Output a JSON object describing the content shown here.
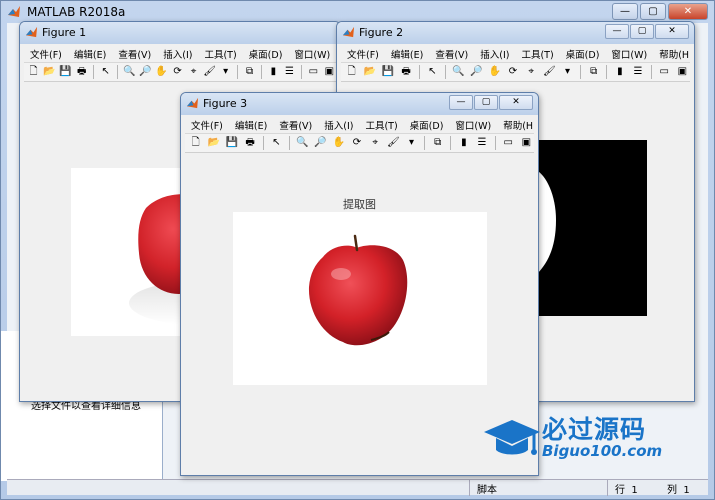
{
  "app": {
    "title": "MATLAB R2018a",
    "controls": {
      "minimize": "—",
      "maximize": "▢",
      "close": "✕"
    }
  },
  "file_browser": {
    "detail_hint": "选择文件以查看详细信息"
  },
  "statusbar": {
    "script_label": "脚本",
    "row_label": "行",
    "row_value": "1",
    "col_label": "列",
    "col_value": "1"
  },
  "figure_menu": [
    "文件(F)",
    "编辑(E)",
    "查看(V)",
    "插入(I)",
    "工具(T)",
    "桌面(D)",
    "窗口(W)",
    "帮助(H)"
  ],
  "figure_toolbar": {
    "overflow_glyph": "»",
    "icons": [
      "new-figure-icon",
      "open-file-icon",
      "save-icon",
      "print-icon",
      "|",
      "pointer-icon",
      "|",
      "zoom-in-icon",
      "zoom-out-icon",
      "pan-icon",
      "rotate-3d-icon",
      "data-cursor-icon",
      "brush-icon",
      "dropdown-arrow-icon",
      "|",
      "link-plot-icon",
      "|",
      "colorbar-icon",
      "legend-icon",
      "|",
      "hide-plot-tools-icon",
      "show-plot-tools-icon"
    ]
  },
  "figures": [
    {
      "id": "figure1",
      "title": "Figure 1",
      "axes_title": ""
    },
    {
      "id": "figure2",
      "title": "Figure 2",
      "axes_title": ""
    },
    {
      "id": "figure3",
      "title": "Figure 3",
      "axes_title": "提取图"
    }
  ],
  "watermark": {
    "brand": "必过源码",
    "url": "Biguo100.com"
  },
  "colors": {
    "apple_red": "#d2232a",
    "watermark_blue": "#1a74c8",
    "figure_bg": "#f0f0f0"
  }
}
